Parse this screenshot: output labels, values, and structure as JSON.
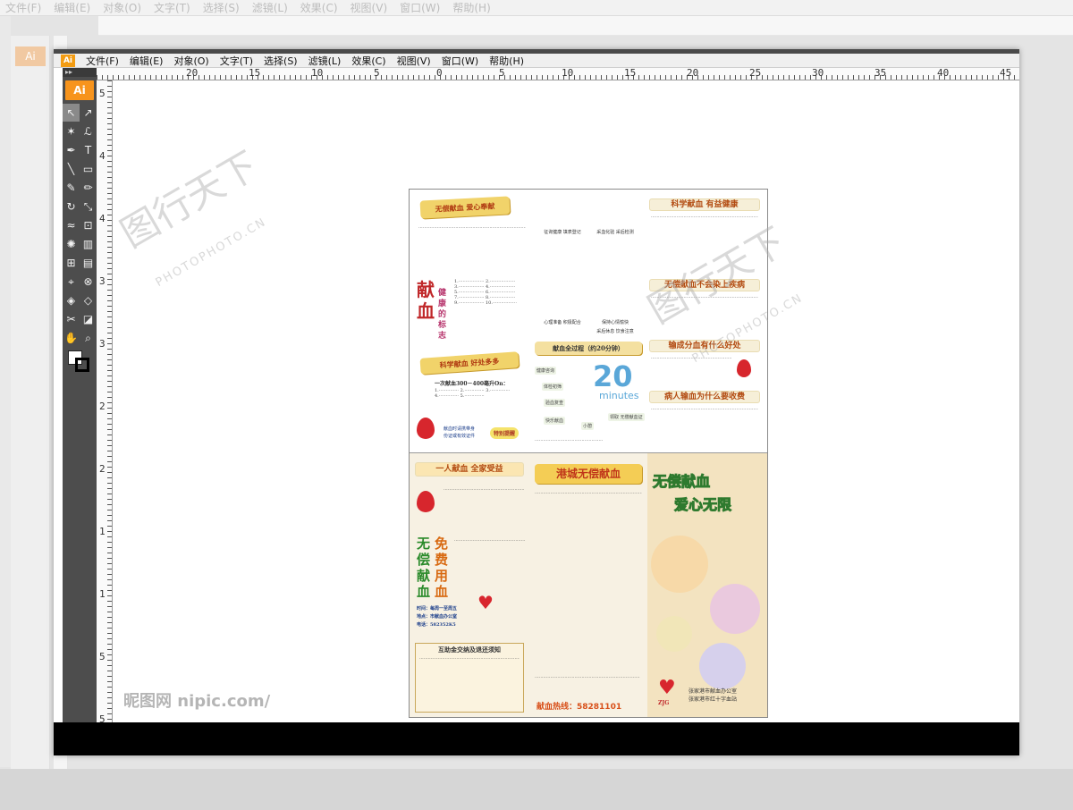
{
  "app": {
    "logo": "Ai",
    "menu": [
      "文件(F)",
      "编辑(E)",
      "对象(O)",
      "文字(T)",
      "选择(S)",
      "滤镜(L)",
      "效果(C)",
      "视图(V)",
      "窗口(W)",
      "帮助(H)"
    ],
    "ghost_menu": [
      "文件(F)",
      "编辑(E)",
      "对象(O)",
      "文字(T)",
      "选择(S)",
      "滤镜(L)",
      "效果(C)",
      "视图(V)",
      "窗口(W)",
      "帮助(H)"
    ]
  },
  "rulers": {
    "top_labels": [
      "20",
      "15",
      "10",
      "5",
      "0",
      "5",
      "10",
      "15",
      "20",
      "25",
      "30",
      "35",
      "40",
      "45"
    ],
    "left_labels": [
      "5",
      "4",
      "4",
      "3",
      "3",
      "2",
      "2",
      "1",
      "1",
      "5",
      "5"
    ]
  },
  "tools": [
    {
      "icon": "selection-tool-icon",
      "glyph": "↖",
      "selected": true
    },
    {
      "icon": "direct-selection-tool-icon",
      "glyph": "↗",
      "selected": false
    },
    {
      "icon": "magic-wand-tool-icon",
      "glyph": "✶",
      "selected": false
    },
    {
      "icon": "lasso-tool-icon",
      "glyph": "ℒ",
      "selected": false
    },
    {
      "icon": "pen-tool-icon",
      "glyph": "✒",
      "selected": false
    },
    {
      "icon": "type-tool-icon",
      "glyph": "T",
      "selected": false
    },
    {
      "icon": "line-tool-icon",
      "glyph": "╲",
      "selected": false
    },
    {
      "icon": "rectangle-tool-icon",
      "glyph": "▭",
      "selected": false
    },
    {
      "icon": "paintbrush-tool-icon",
      "glyph": "✎",
      "selected": false
    },
    {
      "icon": "pencil-tool-icon",
      "glyph": "✏",
      "selected": false
    },
    {
      "icon": "rotate-tool-icon",
      "glyph": "↻",
      "selected": false
    },
    {
      "icon": "scale-tool-icon",
      "glyph": "⤡",
      "selected": false
    },
    {
      "icon": "warp-tool-icon",
      "glyph": "≈",
      "selected": false
    },
    {
      "icon": "free-transform-tool-icon",
      "glyph": "⊡",
      "selected": false
    },
    {
      "icon": "symbol-sprayer-tool-icon",
      "glyph": "✺",
      "selected": false
    },
    {
      "icon": "column-graph-tool-icon",
      "glyph": "▥",
      "selected": false
    },
    {
      "icon": "mesh-tool-icon",
      "glyph": "⊞",
      "selected": false
    },
    {
      "icon": "gradient-tool-icon",
      "glyph": "▤",
      "selected": false
    },
    {
      "icon": "eyedropper-tool-icon",
      "glyph": "⌖",
      "selected": false
    },
    {
      "icon": "blend-tool-icon",
      "glyph": "⊗",
      "selected": false
    },
    {
      "icon": "live-paint-tool-icon",
      "glyph": "◈",
      "selected": false
    },
    {
      "icon": "live-paint-selection-tool-icon",
      "glyph": "◇",
      "selected": false
    },
    {
      "icon": "slice-tool-icon",
      "glyph": "✂",
      "selected": false
    },
    {
      "icon": "eraser-tool-icon",
      "glyph": "◪",
      "selected": false
    },
    {
      "icon": "hand-tool-icon",
      "glyph": "✋",
      "selected": false
    },
    {
      "icon": "zoom-tool-icon",
      "glyph": "⌕",
      "selected": false
    }
  ],
  "brochure": {
    "top": {
      "ribbon1": "无偿献血 爱心奉献",
      "big_red": "献血",
      "health_vertical": "健康的标志",
      "ribbon2": "科学献血 好处多多",
      "blood_amount": "一次献血300－400毫升On：",
      "side_labels": [
        "献血时请携带身",
        "份证或有效证件"
      ],
      "tagline": "特别提醒",
      "flow_head": "献血全过程（约20分钟）",
      "minutes_num": "20",
      "minutes_word": "minutes",
      "steps": [
        "健康咨询",
        "体检初筛",
        "验血复查",
        "快乐献血",
        "小憩",
        "领取 无偿献血证"
      ],
      "col2_labels": [
        "征询健康 填表登记",
        "采血化验 采后检测",
        "心理准备 积极配合",
        "保持心情愉快",
        "采后休息 饮食注意"
      ],
      "right_heads": [
        "科学献血 有益健康",
        "无偿献血不会染上疾病",
        "输成分血有什么好处",
        "病人输血为什么要收费"
      ]
    },
    "bottom": {
      "head1": "一人献血 全家受益",
      "ribbon_title": "港城无偿献血",
      "slogan_l1": "无偿献血",
      "slogan_l2": "爱心无限",
      "green_cn": "无偿献血",
      "orange_cn": "免费用血",
      "contact_rows": [
        "时间：每周一至周五",
        "地点：市献血办公室",
        "电话：582352K5"
      ],
      "box_title": "互助金交纳及退还须知",
      "hotline_label": "献血热线：58281101",
      "org_lines": [
        "张家港市献血办公室",
        "张家港市红十字血站"
      ],
      "logo_text": "ZJG"
    }
  },
  "watermarks": {
    "main_cn": "图行天下",
    "sub": "PHOTOPHOTO.CN",
    "nipic": "昵图网 nipic.com/"
  }
}
